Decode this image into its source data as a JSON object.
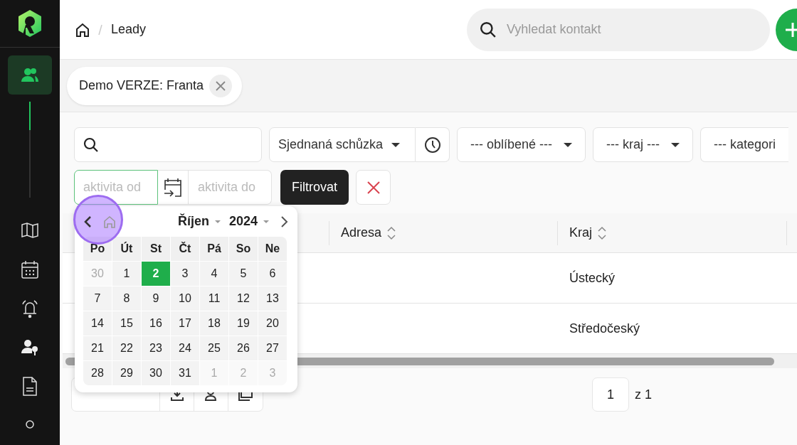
{
  "sidebar": {
    "items": [
      {
        "selected": true
      },
      {
        "selected": false
      },
      {
        "selected": false
      },
      {
        "selected": false
      },
      {
        "selected": false
      },
      {
        "selected": false
      },
      {
        "selected": false
      }
    ]
  },
  "breadcrumb": {
    "current": "Leady"
  },
  "search": {
    "placeholder": "Vyhledat kontakt"
  },
  "tabs": [
    {
      "label": "Demo VERZE: Franta"
    }
  ],
  "filters": {
    "status": "Sjednaná schůzka",
    "dropdowns": [
      "--- oblíbené ---",
      "--- kraj ---",
      "--- kategori"
    ],
    "date_from": {
      "placeholder": "aktivita od",
      "focused": true
    },
    "date_to": {
      "placeholder": "aktivita do"
    },
    "apply": "Filtrovat"
  },
  "table": {
    "columns": [
      "Adresa",
      "Kraj"
    ],
    "rows": [
      {
        "region": "Ústecký"
      },
      {
        "region": "Středočeský"
      }
    ]
  },
  "footer": {
    "page": "1",
    "of": "z 1"
  },
  "calendar": {
    "month": "Říjen",
    "year": "2024",
    "weekdays": [
      "Po",
      "Út",
      "St",
      "Čt",
      "Pá",
      "So",
      "Ne"
    ],
    "days": [
      {
        "label": "30",
        "kind": "other",
        "selected": false
      },
      {
        "label": "1",
        "kind": "day",
        "selected": false
      },
      {
        "label": "2",
        "kind": "day",
        "selected": true
      },
      {
        "label": "3",
        "kind": "day",
        "selected": false
      },
      {
        "label": "4",
        "kind": "day",
        "selected": false
      },
      {
        "label": "5",
        "kind": "day",
        "selected": false
      },
      {
        "label": "6",
        "kind": "day",
        "selected": false
      },
      {
        "label": "7",
        "kind": "day",
        "selected": false
      },
      {
        "label": "8",
        "kind": "day",
        "selected": false
      },
      {
        "label": "9",
        "kind": "day",
        "selected": false
      },
      {
        "label": "10",
        "kind": "day",
        "selected": false
      },
      {
        "label": "11",
        "kind": "day",
        "selected": false
      },
      {
        "label": "12",
        "kind": "day",
        "selected": false
      },
      {
        "label": "13",
        "kind": "day",
        "selected": false
      },
      {
        "label": "14",
        "kind": "day",
        "selected": false
      },
      {
        "label": "15",
        "kind": "day",
        "selected": false
      },
      {
        "label": "16",
        "kind": "day",
        "selected": false
      },
      {
        "label": "17",
        "kind": "day",
        "selected": false
      },
      {
        "label": "18",
        "kind": "day",
        "selected": false
      },
      {
        "label": "19",
        "kind": "day",
        "selected": false
      },
      {
        "label": "20",
        "kind": "day",
        "selected": false
      },
      {
        "label": "21",
        "kind": "day",
        "selected": false
      },
      {
        "label": "22",
        "kind": "day",
        "selected": false
      },
      {
        "label": "23",
        "kind": "day",
        "selected": false
      },
      {
        "label": "24",
        "kind": "day",
        "selected": false
      },
      {
        "label": "25",
        "kind": "day",
        "selected": false
      },
      {
        "label": "26",
        "kind": "day",
        "selected": false
      },
      {
        "label": "27",
        "kind": "day",
        "selected": false
      },
      {
        "label": "28",
        "kind": "day",
        "selected": false
      },
      {
        "label": "29",
        "kind": "day",
        "selected": false
      },
      {
        "label": "30",
        "kind": "day",
        "selected": false
      },
      {
        "label": "31",
        "kind": "day",
        "selected": false
      },
      {
        "label": "1",
        "kind": "other",
        "selected": false
      },
      {
        "label": "2",
        "kind": "other",
        "selected": false
      },
      {
        "label": "3",
        "kind": "other",
        "selected": false
      }
    ]
  }
}
